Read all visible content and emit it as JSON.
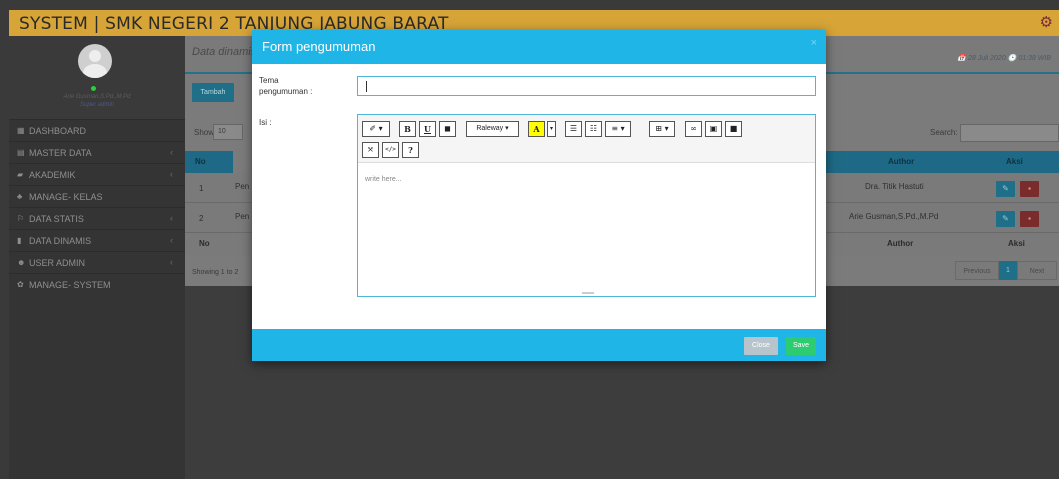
{
  "app": {
    "title": "SYSTEM | SMK NEGERI 2 TANJUNG JABUNG BARAT",
    "settings_icon": "gear-icon"
  },
  "sidebar": {
    "user_name": "Arie Gusman,S.Pd.,M.Pd",
    "user_role": "Super admin",
    "items": [
      {
        "label": "DASHBOARD",
        "icon": "dashboard-icon",
        "glyph": "▦",
        "chevron": ""
      },
      {
        "label": "MASTER DATA",
        "icon": "database-icon",
        "glyph": "▤",
        "chevron": "‹"
      },
      {
        "label": "AKADEMIK",
        "icon": "book-icon",
        "glyph": "▰",
        "chevron": "‹"
      },
      {
        "label": "MANAGE- KELAS",
        "icon": "sitemap-icon",
        "glyph": "♣",
        "chevron": ""
      },
      {
        "label": "DATA STATIS",
        "icon": "flag-icon",
        "glyph": "⚐",
        "chevron": "‹"
      },
      {
        "label": "DATA DINAMIS",
        "icon": "bar-chart-icon",
        "glyph": "▮",
        "chevron": "‹"
      },
      {
        "label": "USER ADMIN",
        "icon": "users-icon",
        "glyph": "☻",
        "chevron": "‹"
      },
      {
        "label": "MANAGE- SYSTEM",
        "icon": "cog-icon",
        "glyph": "✿",
        "chevron": ""
      }
    ]
  },
  "main": {
    "breadcrumb": "Data dinamis",
    "datetime": "📅 28 Juli 2020 🕒 01:38 WIB",
    "add_button": "Tambah",
    "show_label": "Show",
    "show_value": "10",
    "search_label": "Search:",
    "table": {
      "headers": {
        "no": "No",
        "author": "Author",
        "aksi": "Aksi"
      },
      "rows": [
        {
          "no": "1",
          "title": "Pen",
          "author": "Dra. Titik Hastuti"
        },
        {
          "no": "2",
          "title": "Pen",
          "author": "Arie Gusman,S.Pd.,M.Pd"
        }
      ],
      "footer": {
        "no": "No",
        "author": "Author",
        "aksi": "Aksi"
      }
    },
    "showing": "Showing 1 to 2",
    "pager": {
      "previous": "Previous",
      "current": "1",
      "next": "Next"
    }
  },
  "modal": {
    "title": "Form pengumuman",
    "close_x": "×",
    "tema_label": "Tema pengumuman :",
    "tema_value": "",
    "isi_label": "Isi :",
    "editor_placeholder": "write here...",
    "font_name": "Raleway",
    "toolbar": {
      "style": "✐ ▾",
      "bold": "B",
      "underline": "U",
      "eraser": "◼",
      "color": "A",
      "color_dd": "▾",
      "ul": "☰",
      "ol": "☷",
      "align": "≡ ▾",
      "table": "⊞ ▾",
      "link": "∞",
      "image": "▣",
      "video": "■",
      "fullscreen": "⤧",
      "code": "</>",
      "help": "?"
    },
    "close_button": "Close",
    "save_button": "Save"
  }
}
